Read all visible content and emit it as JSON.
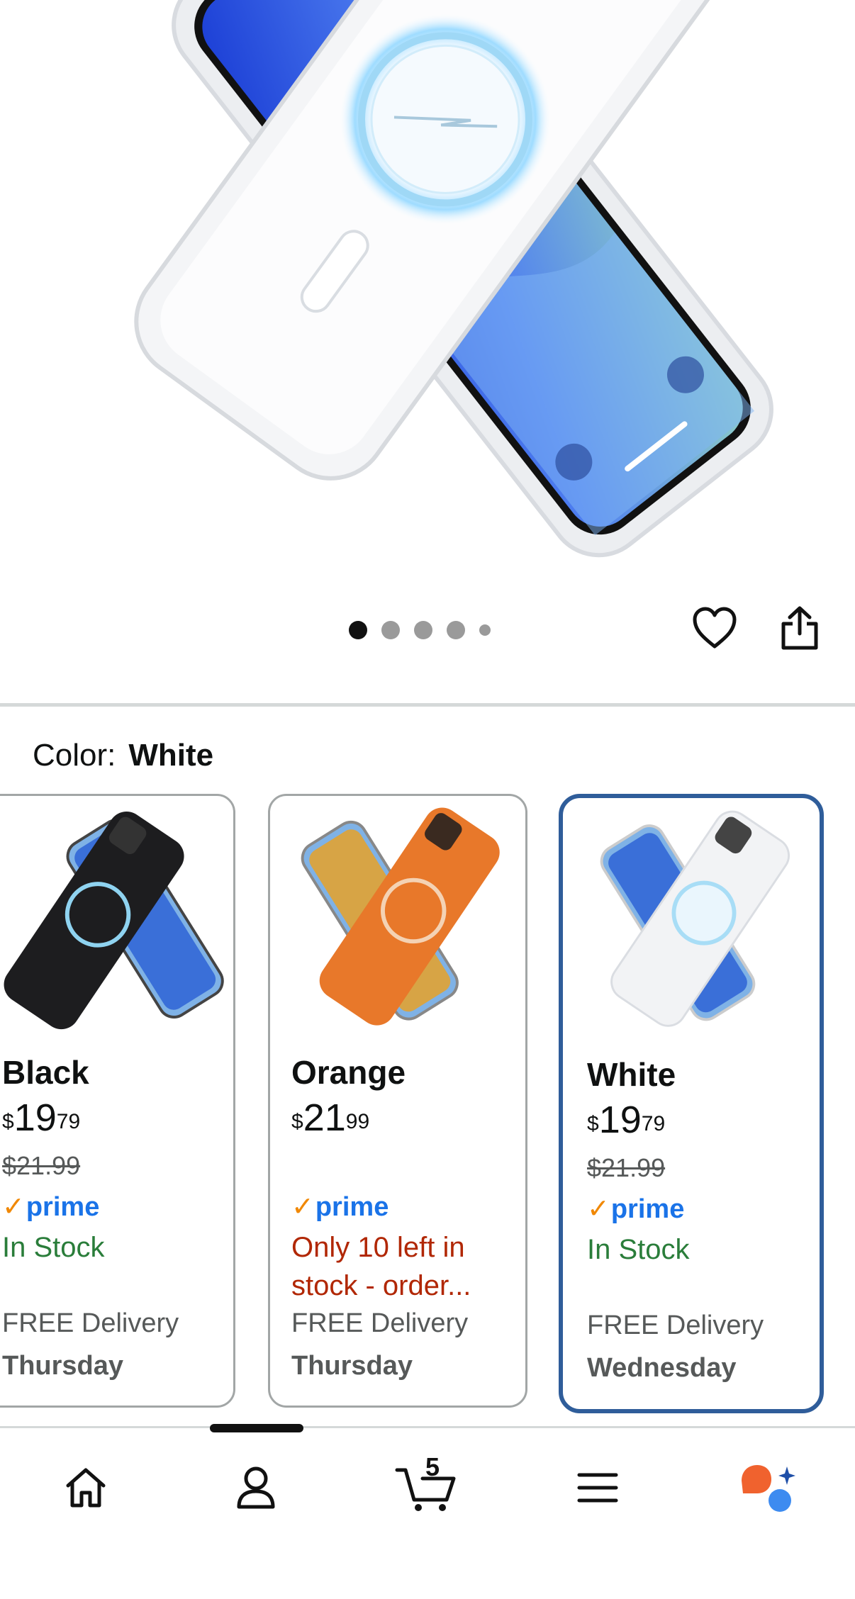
{
  "gallery": {
    "dots_total": 5,
    "active_dot": 0
  },
  "actions": {
    "wishlist_icon": "heart-icon",
    "share_icon": "share-icon"
  },
  "color_selector": {
    "label": "Color:",
    "selected": "White"
  },
  "variants": [
    {
      "name": "Black",
      "price_currency": "$",
      "price_whole": "19",
      "price_cents": "79",
      "list_price": "$21.99",
      "prime": "prime",
      "stock": "In Stock",
      "delivery": "FREE Delivery",
      "delivery_day": "Thursday",
      "case_color": "#1d1d1f"
    },
    {
      "name": "Orange",
      "price_currency": "$",
      "price_whole": "21",
      "price_cents": "99",
      "list_price": "",
      "prime": "prime",
      "stock": "Only 10 left in stock - order...",
      "delivery": "FREE Delivery",
      "delivery_day": "Thursday",
      "case_color": "#e8782a"
    },
    {
      "name": "White",
      "price_currency": "$",
      "price_whole": "19",
      "price_cents": "79",
      "list_price": "$21.99",
      "prime": "prime",
      "stock": "In Stock",
      "delivery": "FREE Delivery",
      "delivery_day": "Wednesday",
      "case_color": "#f2f3f5"
    }
  ],
  "bottom_nav": {
    "items": [
      "home-icon",
      "account-icon",
      "cart-icon",
      "menu-icon",
      "assistant-icon"
    ],
    "cart_count": "5"
  },
  "colors": {
    "selected_border": "#2f5d9a",
    "prime_blue": "#1a73e8",
    "prime_check": "#f08804",
    "in_stock_green": "#2a7d3a",
    "low_stock_red": "#b12704",
    "assistant_orange": "#f0622e",
    "assistant_blue": "#3d8bf0"
  }
}
